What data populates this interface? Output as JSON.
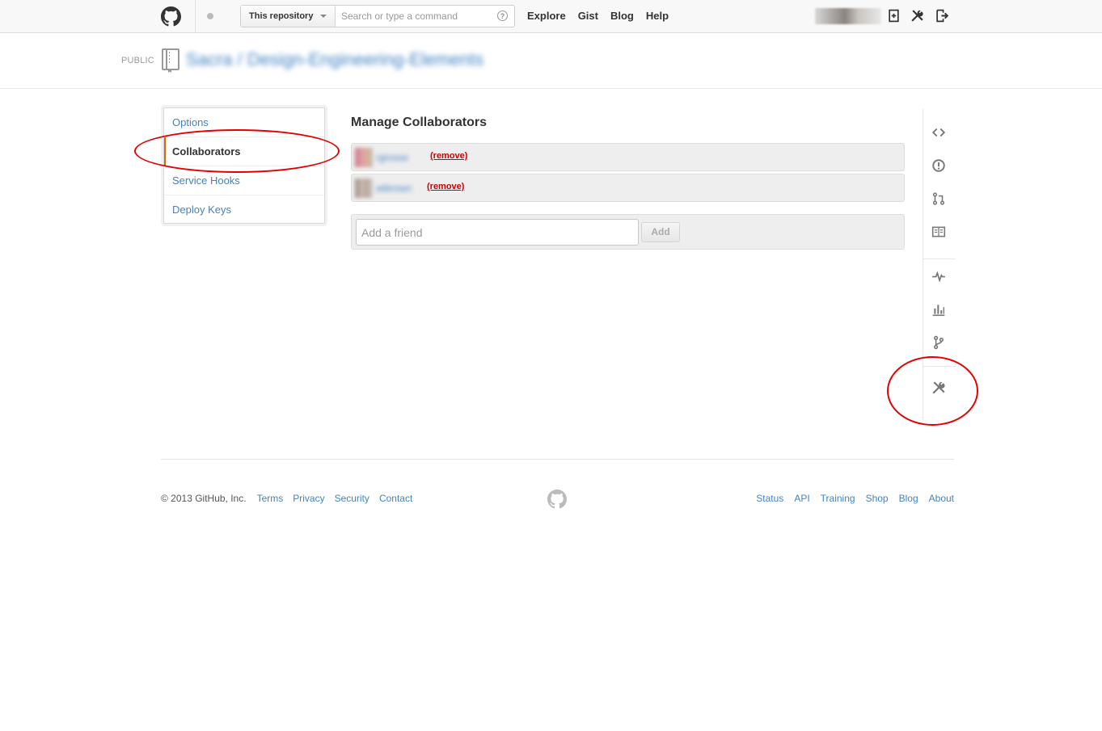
{
  "header": {
    "logo": "github-octocat-icon",
    "search": {
      "scope_label": "This repository",
      "placeholder": "Search or type a command",
      "help_symbol": "?"
    },
    "nav": [
      "Explore",
      "Gist",
      "Blog",
      "Help"
    ],
    "icons": [
      "new-repo-icon",
      "account-settings-icon",
      "sign-out-icon"
    ]
  },
  "repo": {
    "visibility": "PUBLIC",
    "name_blurred": "Sacra / Design-Engineering-Elements"
  },
  "settings_menu": {
    "items": [
      "Options",
      "Collaborators",
      "Service Hooks",
      "Deploy Keys"
    ],
    "selected": "Collaborators"
  },
  "main": {
    "title": "Manage Collaborators",
    "collaborators": [
      {
        "name_blurred": "rgrosse",
        "remove_label": "(remove)"
      },
      {
        "name_blurred": "wibrown",
        "remove_label": "(remove)"
      }
    ],
    "add": {
      "placeholder": "Add a friend",
      "button_label": "Add"
    }
  },
  "repo_nav": {
    "icons": [
      "code-icon",
      "issues-icon",
      "pull-requests-icon",
      "wiki-icon",
      "pulse-icon",
      "graphs-icon",
      "network-icon",
      "settings-icon"
    ]
  },
  "footer": {
    "copyright": "© 2013 GitHub, Inc.",
    "left_links": [
      "Terms",
      "Privacy",
      "Security",
      "Contact"
    ],
    "right_links": [
      "Status",
      "API",
      "Training",
      "Shop",
      "Blog",
      "About"
    ]
  },
  "colors": {
    "link": "#4183c4",
    "selected_bar": "#d26911",
    "remove": "#cc0000",
    "annotation": "#e60000"
  }
}
